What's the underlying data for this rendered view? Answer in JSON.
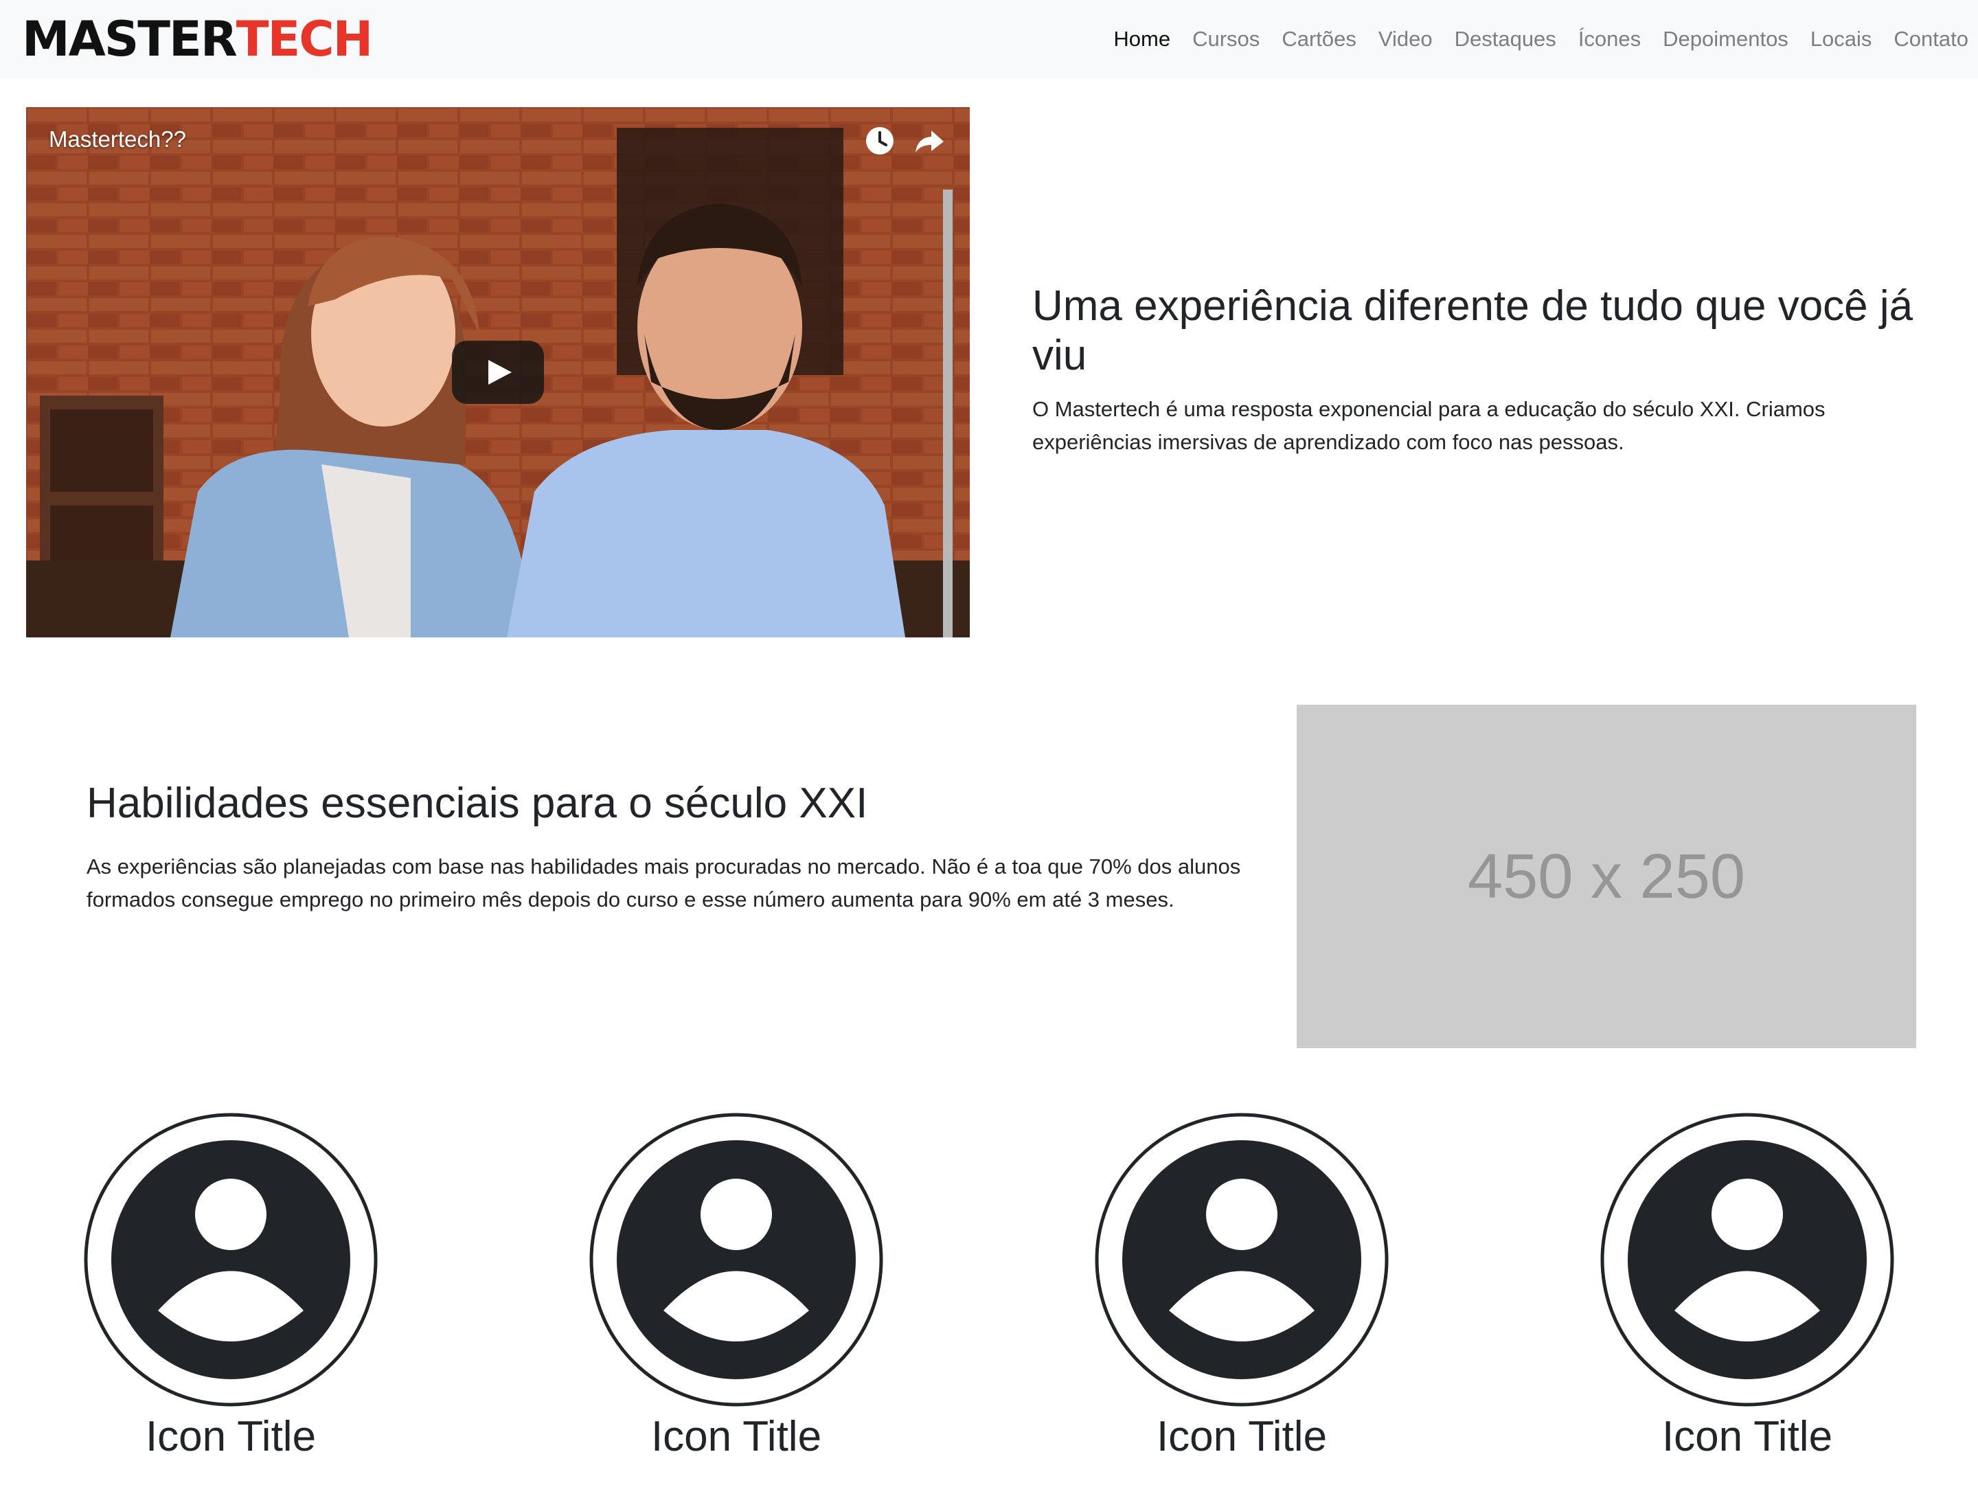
{
  "brand": {
    "part1": "MASTER",
    "part2": "TECH"
  },
  "nav": {
    "items": [
      {
        "label": "Home",
        "active": true
      },
      {
        "label": "Cursos",
        "active": false
      },
      {
        "label": "Cartões",
        "active": false
      },
      {
        "label": "Video",
        "active": false
      },
      {
        "label": "Destaques",
        "active": false
      },
      {
        "label": "Ícones",
        "active": false
      },
      {
        "label": "Depoimentos",
        "active": false
      },
      {
        "label": "Locais",
        "active": false
      },
      {
        "label": "Contato",
        "active": false
      }
    ]
  },
  "video": {
    "title": "Mastertech??",
    "controls": [
      "clock-icon",
      "share-icon",
      "play-icon"
    ]
  },
  "intro": {
    "heading": "Uma experiência diferente de tudo que você já viu",
    "text": "O Mastertech é uma resposta exponencial para a educação do século XXI. Criamos experiências imersivas de aprendizado com foco nas pessoas."
  },
  "skills": {
    "heading": "Habilidades essenciais para o século XXI",
    "text": "As experiências são planejadas com base nas habilidades mais procuradas no mercado. Não é a toa que 70% dos alunos formados consegue emprego no primeiro mês depois do curso e esse número aumenta para 90% em até 3 meses.",
    "placeholder": "450 x 250"
  },
  "icons": {
    "items": [
      {
        "title": "Icon Title",
        "icon": "user-icon"
      },
      {
        "title": "Icon Title",
        "icon": "user-icon"
      },
      {
        "title": "Icon Title",
        "icon": "user-icon"
      },
      {
        "title": "Icon Title",
        "icon": "user-icon"
      }
    ]
  },
  "colors": {
    "brand_dark": "#111111",
    "brand_accent": "#e8352a",
    "navbar_bg": "#f8f9fa",
    "nav_muted": "#7b7e82",
    "text": "#212529",
    "placeholder_bg": "#cccccc",
    "placeholder_text": "#969696"
  }
}
